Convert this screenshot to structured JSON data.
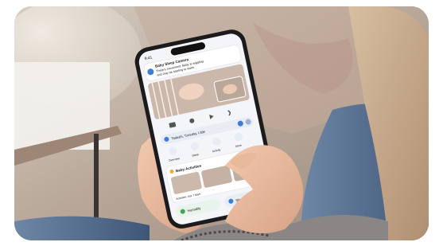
{
  "phone": {
    "status_time": "9:41",
    "notification": {
      "title": "Baby Sleep Camera",
      "line1": "There's movement. Baby is wiggling",
      "line2": "and may be starting to wake."
    },
    "video_label": "Live",
    "chip_label": "Tadashi, Tuesday, Little",
    "quick_actions": [
      "Overview",
      "Sleep",
      "Activity",
      "More"
    ],
    "section_title": "Baby Activities",
    "section_footer": "Activities, last 7 days",
    "bottom_buttons": [
      "Humidity",
      "Sleep"
    ]
  }
}
